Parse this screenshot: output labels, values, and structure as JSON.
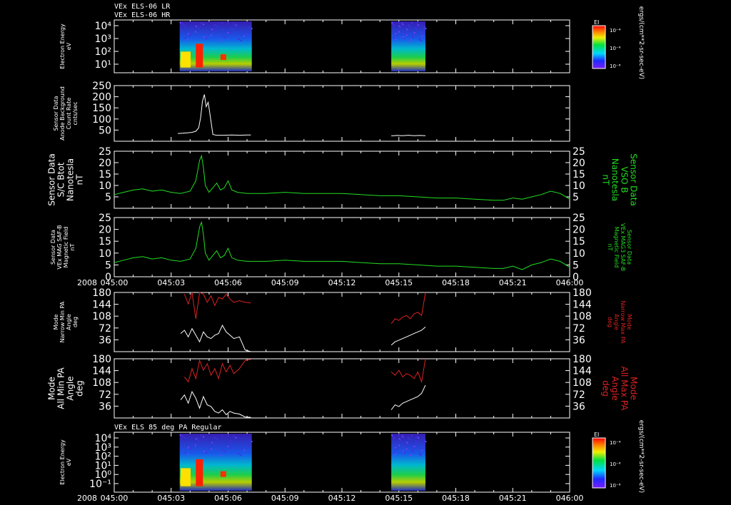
{
  "header": {
    "line1": "VEx ELS-06 LR",
    "line2": "VEx ELS-06 HR"
  },
  "colors": {
    "white": "#ffffff",
    "green": "#22dd22",
    "red": "#dd2222",
    "background": "#000000"
  },
  "time_axis": {
    "year_label": "2008",
    "ticks": [
      "045:00",
      "045:03",
      "045:06",
      "045:09",
      "045:12",
      "045:15",
      "045:18",
      "045:21",
      "046:00"
    ]
  },
  "chart_data": [
    {
      "type": "heatmap",
      "panel_title": "",
      "ylabel": [
        "Electron Energy",
        "eV"
      ],
      "yscale": "log",
      "yticks": [
        "10⁴",
        "10³",
        "10²",
        "10¹"
      ],
      "colorbar": {
        "label": "EI",
        "ticks": [
          "10⁻⁴",
          "10⁻⁶",
          "10⁻⁸"
        ]
      },
      "colorbar_units": "ergs/(cm**2-sr-sec-eV)",
      "data_intervals": [
        [
          "045:03.4",
          "045:07.2"
        ],
        [
          "045:14.6",
          "045:16.4"
        ]
      ]
    },
    {
      "type": "line",
      "ylabel": [
        "Sensor Data",
        "Anode Background",
        "Count Rate",
        "cnts/sec"
      ],
      "ylim": [
        0,
        250
      ],
      "yticks": [
        "250",
        "200",
        "150",
        "100",
        "50"
      ],
      "series": [
        {
          "color": "#ffffff",
          "x": [
            3.35,
            3.6,
            3.9,
            4.1,
            4.3,
            4.45,
            4.55,
            4.65,
            4.75,
            4.85,
            4.95,
            5.05,
            5.2,
            5.4,
            5.8,
            6.2,
            6.6,
            7.0,
            7.2
          ],
          "y": [
            35,
            36,
            38,
            40,
            45,
            60,
            105,
            180,
            210,
            155,
            175,
            120,
            30,
            27,
            27,
            28,
            27,
            28,
            28
          ]
        },
        {
          "color": "#ffffff",
          "x": [
            14.6,
            14.9,
            15.2,
            15.5,
            15.8,
            16.1,
            16.4
          ],
          "y": [
            24,
            26,
            25,
            27,
            25,
            26,
            25
          ]
        }
      ]
    },
    {
      "type": "line",
      "ylabel": [
        "Sensor Data",
        "S/C Btot",
        "Nanotesla",
        "nT"
      ],
      "right_label": [
        "Sensor Data",
        "VSO B",
        "Nanotesla",
        "nT"
      ],
      "ylim": [
        0,
        25
      ],
      "yticks": [
        "25",
        "20",
        "15",
        "10",
        "5"
      ],
      "series": [
        {
          "color": "#22dd22",
          "x": [
            0,
            0.5,
            1,
            1.5,
            2,
            2.5,
            3,
            3.5,
            4,
            4.3,
            4.5,
            4.6,
            4.7,
            4.8,
            5.0,
            5.2,
            5.4,
            5.6,
            5.8,
            6.0,
            6.2,
            6.5,
            7,
            8,
            9,
            10,
            11,
            12,
            13,
            14,
            15,
            16,
            17,
            18,
            19,
            20,
            20.5,
            21,
            21.5,
            22,
            22.5,
            23,
            23.5,
            24
          ],
          "y": [
            6,
            7,
            8,
            8.5,
            7.5,
            8,
            7,
            6.5,
            7.5,
            12,
            21,
            23,
            18,
            10,
            7,
            9,
            11,
            8,
            9,
            12,
            8,
            7,
            6.5,
            6.5,
            7,
            6.5,
            6.5,
            6.5,
            6,
            5.5,
            5.5,
            5,
            4.5,
            4.5,
            4,
            3.5,
            3.5,
            4.5,
            4,
            5,
            6,
            7.5,
            6.5,
            4
          ]
        }
      ]
    },
    {
      "type": "line",
      "ylabel": [
        "Sensor Data",
        "VEx MAG SAF-B",
        "Magnetic Field",
        "nT"
      ],
      "right_label": [
        "Sensor Data",
        "VEx MAG3 SAF-B",
        "Magnetic Field",
        "nT"
      ],
      "ylim": [
        0,
        25
      ],
      "yticks": [
        "25",
        "20",
        "15",
        "10",
        "5",
        "0"
      ],
      "series": [
        {
          "color": "#22dd22",
          "x": [
            0,
            0.5,
            1,
            1.5,
            2,
            2.5,
            3,
            3.5,
            4,
            4.3,
            4.5,
            4.6,
            4.7,
            4.8,
            5.0,
            5.2,
            5.4,
            5.6,
            5.8,
            6.0,
            6.2,
            6.5,
            7,
            8,
            9,
            10,
            11,
            12,
            13,
            14,
            15,
            16,
            17,
            18,
            19,
            20,
            20.5,
            21,
            21.5,
            22,
            22.5,
            23,
            23.5,
            24
          ],
          "y": [
            6,
            7,
            8,
            8.5,
            7.5,
            8,
            7,
            6.5,
            7.5,
            12,
            21,
            23,
            18,
            10,
            7,
            9,
            11,
            8,
            9,
            12,
            8,
            7,
            6.5,
            6.5,
            7,
            6.5,
            6.5,
            6.5,
            6,
            5.5,
            5.5,
            5,
            4.5,
            4.5,
            4,
            3.5,
            3.5,
            4.5,
            3,
            5,
            6,
            7.5,
            6.5,
            4
          ]
        }
      ]
    },
    {
      "type": "line",
      "ylabel": [
        "Mode",
        "Narrow Min PA",
        "Angle",
        "deg"
      ],
      "right_label": [
        "Mode",
        "Narrow Max PA",
        "Angle",
        "deg"
      ],
      "ylim": [
        0,
        180
      ],
      "yticks": [
        "180",
        "144",
        "108",
        "72",
        "36"
      ],
      "series": [
        {
          "name": "",
          "color": "#dd2222",
          "x": [
            3.7,
            3.9,
            4.1,
            4.3,
            4.5,
            4.7,
            4.9,
            5.1,
            5.3,
            5.5,
            5.7,
            5.9,
            6.1,
            6.3,
            6.6,
            6.9,
            7.2
          ],
          "y": [
            175,
            145,
            180,
            100,
            180,
            175,
            150,
            170,
            140,
            165,
            160,
            175,
            160,
            150,
            155,
            150,
            148
          ]
        },
        {
          "name": "",
          "color": "#dd2222",
          "x": [
            14.6,
            14.8,
            15.0,
            15.2,
            15.4,
            15.6,
            15.8,
            16.0,
            16.2,
            16.4
          ],
          "y": [
            85,
            100,
            95,
            105,
            110,
            100,
            115,
            120,
            110,
            180
          ]
        },
        {
          "name": "",
          "color": "#ffffff",
          "x": [
            3.5,
            3.7,
            3.9,
            4.1,
            4.3,
            4.5,
            4.7,
            4.9,
            5.1,
            5.3,
            5.5,
            5.7,
            5.9,
            6.1,
            6.3,
            6.6,
            6.9,
            7.2
          ],
          "y": [
            55,
            65,
            45,
            70,
            50,
            30,
            60,
            45,
            40,
            50,
            55,
            80,
            60,
            50,
            40,
            45,
            5,
            0
          ]
        },
        {
          "name": "",
          "color": "#ffffff",
          "x": [
            14.6,
            14.8,
            15.0,
            15.2,
            15.4,
            15.6,
            15.8,
            16.0,
            16.2,
            16.4
          ],
          "y": [
            20,
            30,
            35,
            40,
            45,
            50,
            55,
            60,
            65,
            75
          ]
        }
      ]
    },
    {
      "type": "line",
      "ylabel": [
        "Mode",
        "All Min PA",
        "Angle",
        "deg"
      ],
      "right_label": [
        "Mode",
        "All Max PA",
        "Angle",
        "deg"
      ],
      "ylim": [
        0,
        180
      ],
      "yticks": [
        "180",
        "144",
        "108",
        "72",
        "36"
      ],
      "series": [
        {
          "name": "",
          "color": "#dd2222",
          "x": [
            3.7,
            3.9,
            4.1,
            4.3,
            4.5,
            4.7,
            4.9,
            5.1,
            5.3,
            5.5,
            5.7,
            5.9,
            6.1,
            6.3,
            6.6,
            6.9,
            7.2
          ],
          "y": [
            125,
            110,
            150,
            120,
            175,
            145,
            165,
            130,
            150,
            120,
            165,
            140,
            160,
            135,
            150,
            175,
            178
          ]
        },
        {
          "name": "",
          "color": "#dd2222",
          "x": [
            14.6,
            14.8,
            15.0,
            15.2,
            15.4,
            15.6,
            15.8,
            16.0,
            16.2,
            16.4
          ],
          "y": [
            140,
            130,
            145,
            125,
            135,
            130,
            120,
            140,
            110,
            180
          ]
        },
        {
          "name": "",
          "color": "#ffffff",
          "x": [
            3.5,
            3.7,
            3.9,
            4.1,
            4.3,
            4.5,
            4.7,
            4.9,
            5.1,
            5.3,
            5.5,
            5.7,
            5.9,
            6.1,
            6.3,
            6.6,
            6.9,
            7.2
          ],
          "y": [
            55,
            70,
            45,
            80,
            60,
            30,
            65,
            40,
            35,
            20,
            15,
            25,
            10,
            20,
            15,
            12,
            3,
            2
          ]
        },
        {
          "name": "",
          "color": "#ffffff",
          "x": [
            14.6,
            14.8,
            15.0,
            15.2,
            15.4,
            15.6,
            15.8,
            16.0,
            16.2,
            16.4
          ],
          "y": [
            25,
            40,
            35,
            45,
            50,
            55,
            60,
            65,
            75,
            100
          ]
        }
      ]
    },
    {
      "type": "heatmap",
      "panel_title": "VEx ELS 85 deg PA Regular",
      "ylabel": [
        "Electron Energy",
        "eV"
      ],
      "yscale": "log",
      "yticks": [
        "10⁴",
        "10³",
        "10²",
        "10¹",
        "10⁰",
        "10⁻¹"
      ],
      "colorbar": {
        "label": "EI",
        "ticks": [
          "10⁻⁴",
          "10⁻⁶",
          "10⁻⁸"
        ]
      },
      "colorbar_units": "ergs/(cm**2-sr-sec-eV)",
      "data_intervals": [
        [
          "045:03.4",
          "045:07.2"
        ],
        [
          "045:14.6",
          "045:16.4"
        ]
      ]
    }
  ]
}
